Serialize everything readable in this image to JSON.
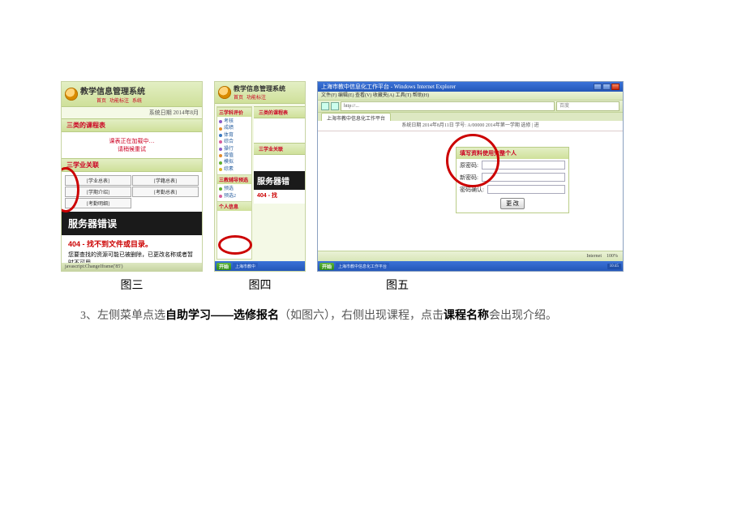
{
  "fig3": {
    "title": "教学信息管理系统",
    "sublinks": [
      "首页",
      "功能标注",
      "系统"
    ],
    "date": "系统日期  2014年8月",
    "section1": "三类的课程表",
    "loading1": "课表正在加载中…",
    "loading2": "请稍候重试",
    "section2": "三学业关联",
    "gridCells": [
      "[学业总表]",
      "[学籍总表]",
      "[学期介绍]",
      "[考勤总表]",
      "[考勤明细]"
    ],
    "errorBand": "服务器错误",
    "err404Title": "404 - 找不到文件或目录。",
    "err404Text": "您要查找的资源可能已被删除，已更改名称或者暂时不可用。",
    "status": "javascript:ChangeIframe('85')"
  },
  "fig4": {
    "title": "教学信息管理系统",
    "sublinks": [
      "首页",
      "功能标注",
      "系统"
    ],
    "sideCat1": "三学科评价",
    "sideItems1": [
      "考核",
      "成绩",
      "体育",
      "综合",
      "操行",
      "增值",
      "模拟",
      "综素"
    ],
    "sideCat2": "三教辅导预选",
    "sideItems2": [
      "预选",
      "预选2"
    ],
    "sideCat3": "个人信息",
    "errorBand": "服务器错",
    "section1": "三类的课程表",
    "section2": "三学业关联",
    "err404Short": "404 - 找",
    "taskbarStart": "开始",
    "taskbarItem": "上海市教中"
  },
  "fig5": {
    "browserTitle": "上海市教中信息化工作平台 - Windows Internet Explorer",
    "ieMenu": "文件(F)  编辑(E)  查看(V)  收藏夹(A)  工具(T)  帮助(H)",
    "addr": "http://...",
    "searchPh": "百度",
    "tab1": "上海市教中信息化工作平台",
    "breadcrumb": "系统日期  2014年8月11日   学号: A/00000  2014年第一学期 选修 | 进",
    "formTitle": "填写资料使用完整个人",
    "formLabel1": "原密码:",
    "formLabel2": "新密码:",
    "formLabel3": "密码确认:",
    "formBtn": "更 改",
    "statusZone": "Internet",
    "statusZoom": "100%",
    "taskbarStart": "开始",
    "taskbarItem": "上海市教中信息化工作平台"
  },
  "captions": {
    "c1": "图三",
    "c2": "图四",
    "c3": "图五"
  },
  "instruction": {
    "prefix": "3、左侧菜单点选",
    "bold1": "自助学习——选修报名",
    "mid": "（如图六），右侧出现课程，点击",
    "bold2": "课程名称",
    "suffix": "会出现介绍。"
  }
}
